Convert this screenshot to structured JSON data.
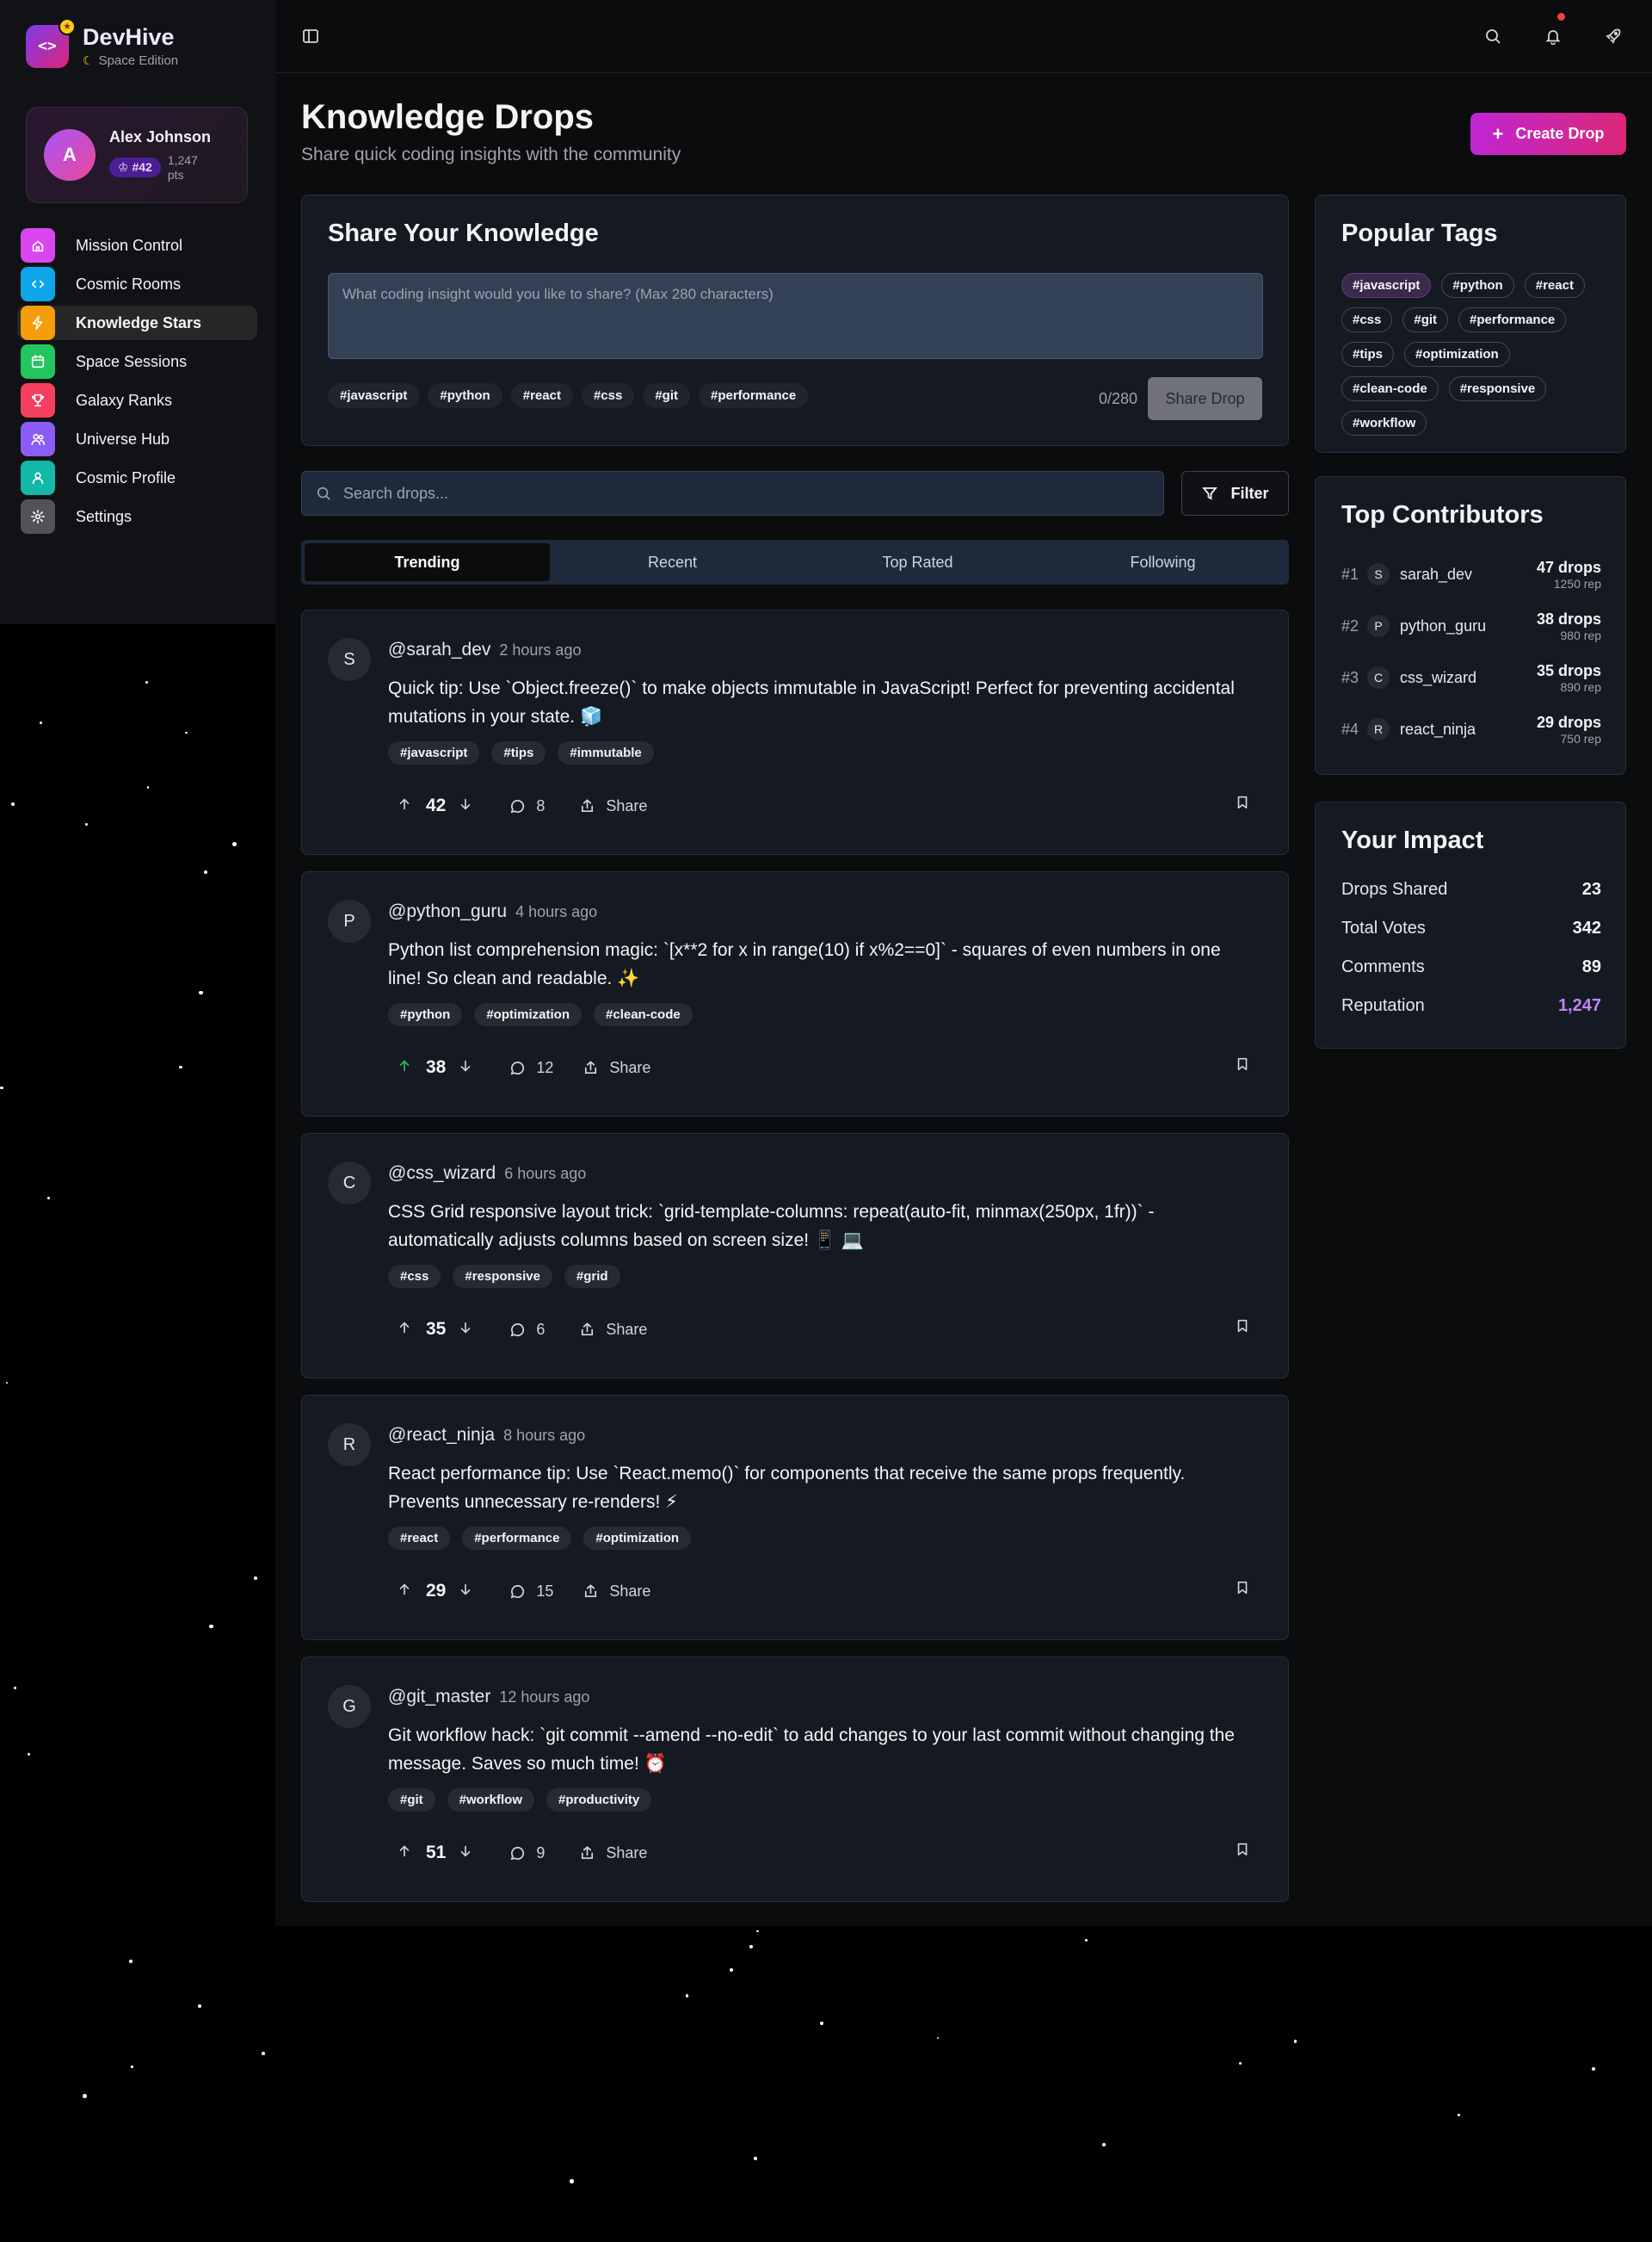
{
  "brand": {
    "name": "DevHive",
    "edition": "Space Edition"
  },
  "user": {
    "name": "Alex Johnson",
    "initial": "A",
    "rank": "#42",
    "points": "1,247 pts"
  },
  "nav": [
    {
      "label": "Mission Control",
      "icon": "home-icon",
      "color": "#d946ef",
      "active": false
    },
    {
      "label": "Cosmic Rooms",
      "icon": "code-icon",
      "color": "#0ea5e9",
      "active": false
    },
    {
      "label": "Knowledge Stars",
      "icon": "bolt-icon",
      "color": "#f59e0b",
      "active": true
    },
    {
      "label": "Space Sessions",
      "icon": "calendar-icon",
      "color": "#22c55e",
      "active": false
    },
    {
      "label": "Galaxy Ranks",
      "icon": "trophy-icon",
      "color": "#f43f5e",
      "active": false
    },
    {
      "label": "Universe Hub",
      "icon": "users-icon",
      "color": "#8b5cf6",
      "active": false
    },
    {
      "label": "Cosmic Profile",
      "icon": "user-icon",
      "color": "#14b8a6",
      "active": false
    },
    {
      "label": "Settings",
      "icon": "gear-icon",
      "color": "#52525b",
      "active": false
    }
  ],
  "header": {
    "title": "Knowledge Drops",
    "subtitle": "Share quick coding insights with the community",
    "create_label": "Create Drop"
  },
  "share": {
    "title": "Share Your Knowledge",
    "placeholder": "What coding insight would you like to share? (Max 280 characters)",
    "tags": [
      "#javascript",
      "#python",
      "#react",
      "#css",
      "#git",
      "#performance"
    ],
    "char_count": "0/280",
    "button": "Share Drop"
  },
  "search": {
    "placeholder": "Search drops...",
    "filter_label": "Filter"
  },
  "tabs": [
    "Trending",
    "Recent",
    "Top Rated",
    "Following"
  ],
  "posts": [
    {
      "initial": "S",
      "user": "@sarah_dev",
      "time": "2 hours ago",
      "body": "Quick tip: Use `Object.freeze()` to make objects immutable in JavaScript! Perfect for preventing accidental mutations in your state. 🧊",
      "tags": [
        "#javascript",
        "#tips",
        "#immutable"
      ],
      "votes": "42",
      "comments": "8",
      "share": "Share",
      "upvoted": false
    },
    {
      "initial": "P",
      "user": "@python_guru",
      "time": "4 hours ago",
      "body": "Python list comprehension magic: `[x**2 for x in range(10) if x%2==0]` - squares of even numbers in one line! So clean and readable. ✨",
      "tags": [
        "#python",
        "#optimization",
        "#clean-code"
      ],
      "votes": "38",
      "comments": "12",
      "share": "Share",
      "upvoted": true
    },
    {
      "initial": "C",
      "user": "@css_wizard",
      "time": "6 hours ago",
      "body": "CSS Grid responsive layout trick: `grid-template-columns: repeat(auto-fit, minmax(250px, 1fr))` - automatically adjusts columns based on screen size! 📱 💻",
      "tags": [
        "#css",
        "#responsive",
        "#grid"
      ],
      "votes": "35",
      "comments": "6",
      "share": "Share",
      "upvoted": false
    },
    {
      "initial": "R",
      "user": "@react_ninja",
      "time": "8 hours ago",
      "body": "React performance tip: Use `React.memo()` for components that receive the same props frequently. Prevents unnecessary re-renders! ⚡",
      "tags": [
        "#react",
        "#performance",
        "#optimization"
      ],
      "votes": "29",
      "comments": "15",
      "share": "Share",
      "upvoted": false
    },
    {
      "initial": "G",
      "user": "@git_master",
      "time": "12 hours ago",
      "body": "Git workflow hack: `git commit --amend --no-edit` to add changes to your last commit without changing the message. Saves so much time! ⏰",
      "tags": [
        "#git",
        "#workflow",
        "#productivity"
      ],
      "votes": "51",
      "comments": "9",
      "share": "Share",
      "upvoted": false
    }
  ],
  "popular_tags": {
    "title": "Popular Tags",
    "tags": [
      "#javascript",
      "#python",
      "#react",
      "#css",
      "#git",
      "#performance",
      "#tips",
      "#optimization",
      "#clean-code",
      "#responsive",
      "#workflow"
    ]
  },
  "contributors": {
    "title": "Top Contributors",
    "items": [
      {
        "rank": "#1",
        "initial": "S",
        "name": "sarah_dev",
        "drops": "47 drops",
        "rep": "1250 rep"
      },
      {
        "rank": "#2",
        "initial": "P",
        "name": "python_guru",
        "drops": "38 drops",
        "rep": "980 rep"
      },
      {
        "rank": "#3",
        "initial": "C",
        "name": "css_wizard",
        "drops": "35 drops",
        "rep": "890 rep"
      },
      {
        "rank": "#4",
        "initial": "R",
        "name": "react_ninja",
        "drops": "29 drops",
        "rep": "750 rep"
      }
    ]
  },
  "impact": {
    "title": "Your Impact",
    "rows": [
      {
        "label": "Drops Shared",
        "value": "23"
      },
      {
        "label": "Total Votes",
        "value": "342"
      },
      {
        "label": "Comments",
        "value": "89"
      },
      {
        "label": "Reputation",
        "value": "1,247"
      }
    ]
  }
}
